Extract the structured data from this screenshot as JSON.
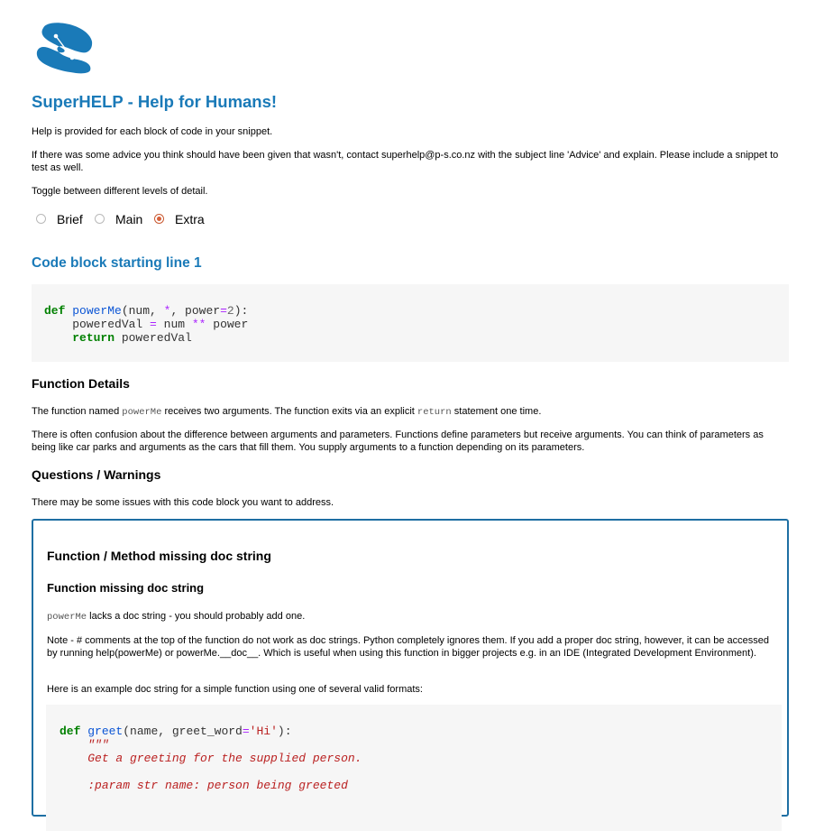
{
  "header": {
    "logo_icon": "superhelp-logo-icon",
    "title": "SuperHELP - Help for Humans!"
  },
  "intro": {
    "line1": "Help is provided for each block of code in your snippet.",
    "line2": "If there was some advice you think should have been given that wasn't, contact superhelp@p-s.co.nz with the subject line 'Advice' and explain. Please include a snippet to test as well.",
    "line3": "Toggle between different levels of detail."
  },
  "detail_levels": {
    "options": [
      "Brief",
      "Main",
      "Extra"
    ],
    "selected": "Extra"
  },
  "code_block": {
    "heading": "Code block starting line 1",
    "lines": [
      "def powerMe(num, *, power=2):",
      "    poweredVal = num ** power",
      "    return poweredVal"
    ]
  },
  "function_details": {
    "heading": "Function Details",
    "p1_pre": "The function named ",
    "p1_code1": "powerMe",
    "p1_mid": " receives two arguments. The function exits via an explicit ",
    "p1_code2": "return",
    "p1_post": " statement one time.",
    "p2": "There is often confusion about the difference between arguments and parameters. Functions define parameters but receive arguments. You can think of parameters as being like car parks and arguments as the cars that fill them. You supply arguments to a function depending on its parameters."
  },
  "questions": {
    "heading": "Questions / Warnings",
    "intro": "There may be some issues with this code block you want to address."
  },
  "warning": {
    "heading": "Function / Method missing doc string",
    "subheading": "Function missing doc string",
    "p1_code": "powerMe",
    "p1_text": " lacks a doc string - you should probably add one.",
    "p2": "Note - # comments at the top of the function do not work as doc strings. Python completely ignores them. If you add a proper doc string, however, it can be accessed by running help(powerMe) or powerMe.__doc__. Which is useful when using this function in bigger projects e.g. in an IDE (Integrated Development Environment).",
    "p3": "Here is an example doc string for a simple function using one of several valid formats:",
    "example_lines": [
      "def greet(name, greet_word='Hi'):",
      "    \"\"\"",
      "    Get a greeting for the supplied person.",
      "",
      "    :param str name: person being greeted"
    ]
  },
  "colors": {
    "accent": "#1a7ab8",
    "warn_border": "#1e6fa3",
    "code_bg": "#f6f6f6",
    "radio_selected": "#d8603a"
  }
}
